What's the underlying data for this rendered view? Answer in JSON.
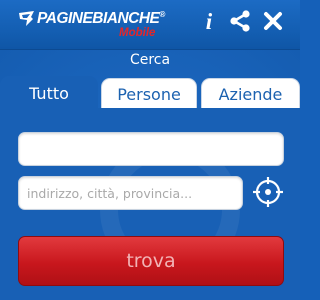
{
  "header": {
    "logo_main": "PAGINEBIANCHE",
    "logo_trademark": "®",
    "logo_sub": "Mobile",
    "info_label": "i"
  },
  "search": {
    "section_title": "Cerca",
    "tabs": [
      {
        "label": "Tutto",
        "active": true
      },
      {
        "label": "Persone",
        "active": false
      },
      {
        "label": "Aziende",
        "active": false
      }
    ],
    "name_field": {
      "value": "",
      "placeholder": ""
    },
    "address_field": {
      "value": "",
      "placeholder": "indirizzo, città, provincia..."
    },
    "submit_label": "trova"
  },
  "icons": {
    "logo": "paginebianche-pin-icon",
    "info": "info-icon",
    "share": "share-icon",
    "close": "close-icon",
    "locate": "crosshair-locate-icon"
  },
  "colors": {
    "brand_blue": "#1860b5",
    "header_blue": "#145fb3",
    "accent_red": "#c8171d",
    "logo_red": "#e3262a",
    "tab_text_blue": "#1c62b0"
  }
}
